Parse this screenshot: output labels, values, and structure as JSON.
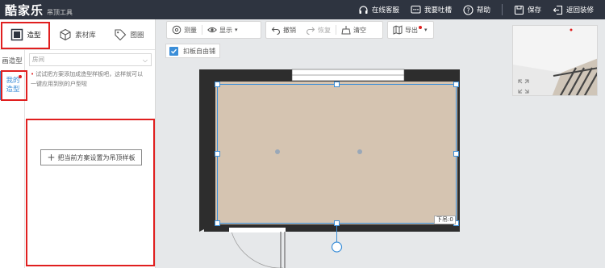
{
  "app": {
    "logo": "酷家乐",
    "subtitle": "吊顶工具"
  },
  "topbar": {
    "service_label": "在线客服",
    "feedback_label": "我要吐槽",
    "help_label": "帮助",
    "save_label": "保存",
    "back_label": "返回装修"
  },
  "left_panel": {
    "tabs": [
      {
        "label": "造型",
        "icon": "square-icon"
      },
      {
        "label": "素材库",
        "icon": "cube-icon"
      },
      {
        "label": "图圈",
        "icon": "tag-icon"
      }
    ],
    "side_items": [
      {
        "label": "画造型"
      },
      {
        "label_line1": "我的",
        "label_line2": "造型"
      }
    ],
    "select_value": "房间",
    "tip_line1": "试试把方案添加成造型样板吧，这样就可以",
    "tip_line2": "一键应用到别的户型啦",
    "set_button_label": "把当前方案设置为吊顶样板"
  },
  "toolbar": {
    "measure_label": "测量",
    "display_label": "显示",
    "undo_label": "撤销",
    "redo_label": "恢复",
    "clear_label": "清空",
    "export_label": "导出"
  },
  "options": {
    "free_tile_label": "扣板自由铺",
    "free_tile_checked": true
  },
  "canvas": {
    "room_label": "下吊:0"
  },
  "colors": {
    "topbar": "#2e3440",
    "accent": "#3b8ed8",
    "highlight": "#e01f1f",
    "floor": "#d5c4b1",
    "wall": "#2d2d2d"
  }
}
